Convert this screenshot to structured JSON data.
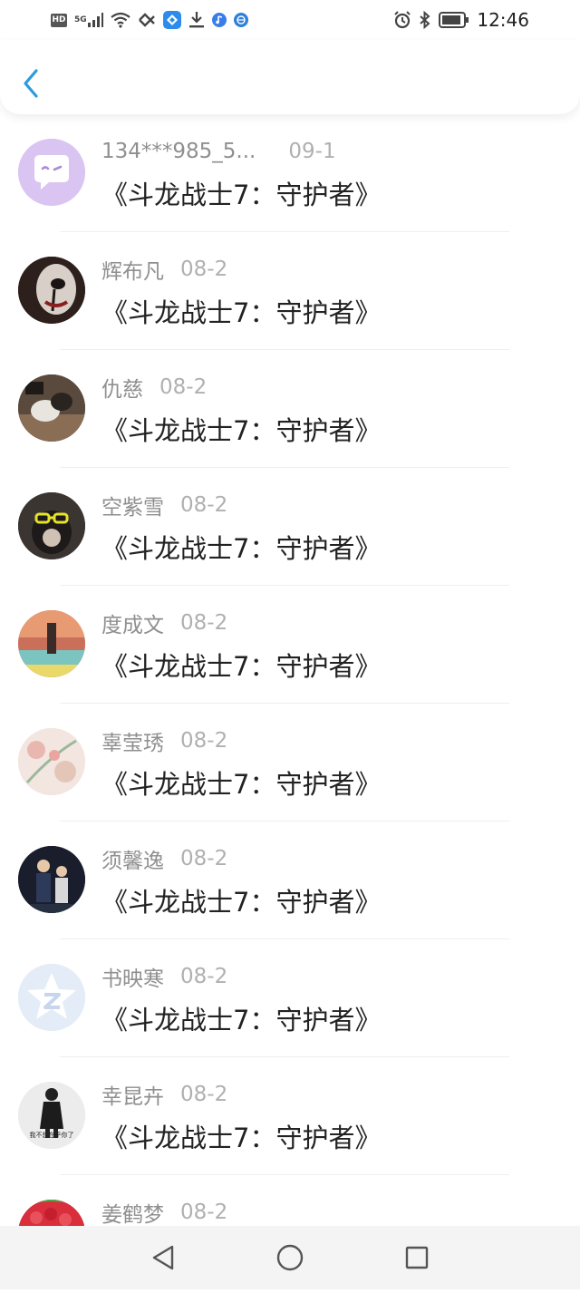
{
  "status_bar": {
    "hd": "HD",
    "network": "5G",
    "time": "12:46",
    "icons": [
      "hd-icon",
      "signal-icon",
      "wifi-icon",
      "nfc-icon",
      "app-icon",
      "download-icon",
      "music-icon",
      "browser-icon",
      "alarm-icon",
      "bluetooth-icon",
      "battery-icon"
    ]
  },
  "header": {
    "back_icon": "chevron-left-icon",
    "accent": "#2a9be0"
  },
  "list": [
    {
      "name": "134***985_5...",
      "date": "09-1",
      "title": "《斗龙战士7：守护者》",
      "avatar_color": "#d9c4f2"
    },
    {
      "name": "辉布凡",
      "date": "08-2",
      "title": "《斗龙战士7：守护者》",
      "avatar_color": "#3a2c28"
    },
    {
      "name": "仇慈",
      "date": "08-2",
      "title": "《斗龙战士7：守护者》",
      "avatar_color": "#4b3e36"
    },
    {
      "name": "空紫雪",
      "date": "08-2",
      "title": "《斗龙战士7：守护者》",
      "avatar_color": "#2f2b2a"
    },
    {
      "name": "度成文",
      "date": "08-2",
      "title": "《斗龙战士7：守护者》",
      "avatar_color": "#e2b68f"
    },
    {
      "name": "辜莹琇",
      "date": "08-2",
      "title": "《斗龙战士7：守护者》",
      "avatar_color": "#f1dcd4"
    },
    {
      "name": "须馨逸",
      "date": "08-2",
      "title": "《斗龙战士7：守护者》",
      "avatar_color": "#1c2233"
    },
    {
      "name": "书映寒",
      "date": "08-2",
      "title": "《斗龙战士7：守护者》",
      "avatar_color": "#e6eef8"
    },
    {
      "name": "幸昆卉",
      "date": "08-2",
      "title": "《斗龙战士7：守护者》",
      "avatar_color": "#dcdcdc"
    },
    {
      "name": "姜鹤梦",
      "date": "08-2",
      "title": "",
      "avatar_color": "#d92e3c"
    }
  ],
  "avatar_texts": {
    "item9": "我不想在乎你了"
  },
  "nav_bar": {
    "back": "nav-back-triangle-icon",
    "home": "nav-home-circle-icon",
    "recents": "nav-recents-square-icon"
  }
}
